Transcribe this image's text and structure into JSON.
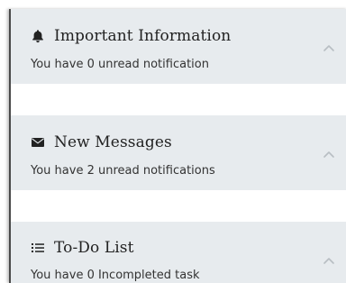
{
  "panels": [
    {
      "title": "Important Information",
      "subtitle": "You have 0 unread notification",
      "icon": "bell-icon"
    },
    {
      "title": "New Messages",
      "subtitle": "You have 2 unread notifications",
      "icon": "envelope-icon"
    },
    {
      "title": "To-Do List",
      "subtitle": "You have 0 Incompleted task",
      "icon": "list-icon"
    }
  ],
  "colors": {
    "panel_bg": "#e7ebee",
    "text": "#222222",
    "subtext": "#333333",
    "chevron": "#b8bec3"
  }
}
